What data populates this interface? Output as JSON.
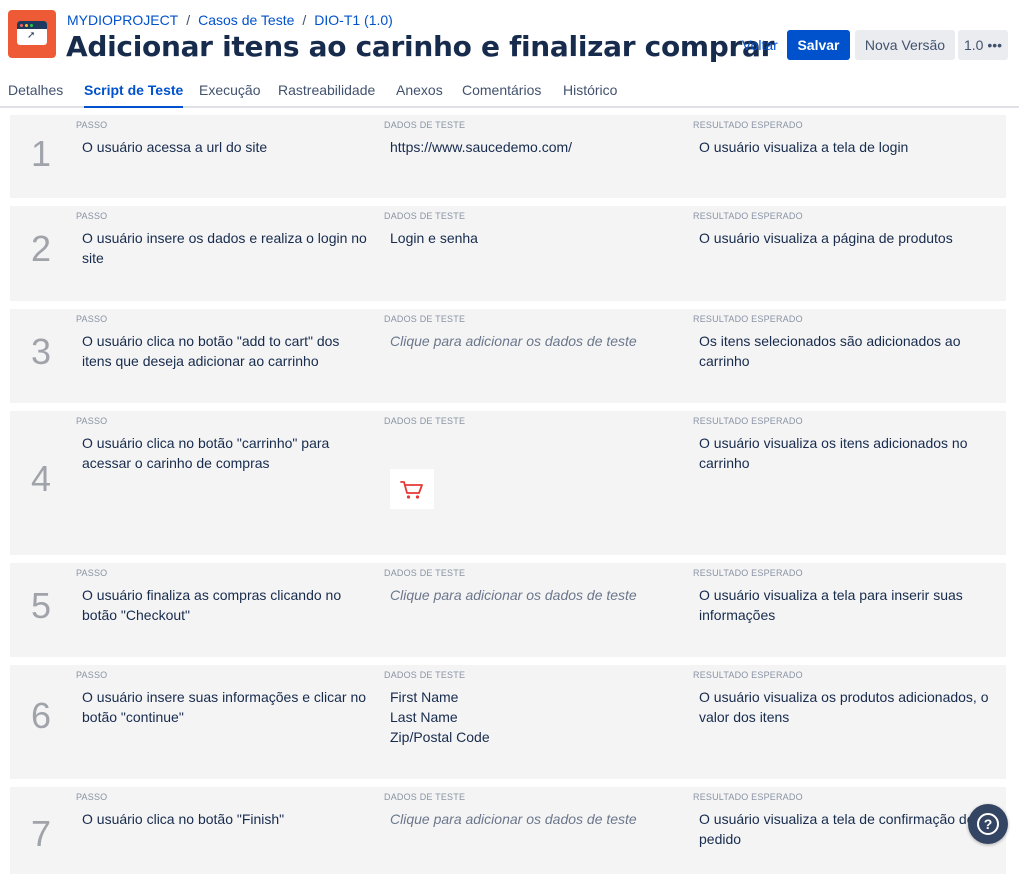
{
  "breadcrumb": {
    "project": "MYDIOPROJECT",
    "section": "Casos de Teste",
    "item": "DIO-T1 (1.0)",
    "separator": "/"
  },
  "title": "Adicionar itens ao carinho e finalizar comprar",
  "actions": {
    "back": "Voltar",
    "save": "Salvar",
    "new_version": "Nova Versão",
    "version": "1.0 •••"
  },
  "tabs": [
    {
      "label": "Detalhes"
    },
    {
      "label": "Script de Teste"
    },
    {
      "label": "Execução"
    },
    {
      "label": "Rastreabilidade"
    },
    {
      "label": "Anexos"
    },
    {
      "label": "Comentários"
    },
    {
      "label": "Histórico"
    }
  ],
  "active_tab": "Script de Teste",
  "columns": {
    "step": "PASSO",
    "data": "DADOS DE TESTE",
    "expected": "RESULTADO ESPERADO"
  },
  "steps": [
    {
      "num": "1",
      "step": "O usuário acessa a url do site",
      "data": "https://www.saucedemo.com/",
      "expected": "O usuário visualiza a tela de login"
    },
    {
      "num": "2",
      "step": "O usuário insere os dados e realiza o login no site",
      "data": "Login e senha",
      "expected": "O usuário visualiza a página de produtos"
    },
    {
      "num": "3",
      "step": "O usuário clica no botão \"add to cart\" dos itens que deseja adicionar ao carrinho",
      "data": "Clique para adicionar os dados de teste",
      "expected": "Os itens selecionados são adicionados ao carrinho"
    },
    {
      "num": "4",
      "step": "O usuário clica no botão \"carrinho\" para acessar o carinho de compras",
      "data": "",
      "expected": "O usuário visualiza os itens adicionados no carrinho"
    },
    {
      "num": "5",
      "step": "O usuário finaliza as compras clicando no botão \"Checkout\"",
      "data": "Clique para adicionar os dados de teste",
      "expected": "O usuário visualiza a tela para inserir suas informações"
    },
    {
      "num": "6",
      "step": "O usuário insere suas informações e clicar no botão \"continue\"",
      "data_lines": [
        "First Name",
        "Last Name",
        "Zip/Postal Code"
      ],
      "expected": "O usuário visualiza os produtos adicionados, o valor dos itens"
    },
    {
      "num": "7",
      "step": "O usuário clica no botão \"Finish\"",
      "data": "Clique para adicionar os dados de teste",
      "expected": "O usuário visualiza a tela de confirmação do pedido"
    }
  ],
  "icons": {
    "project_avatar": "project-window-icon",
    "cart": "shopping-cart-icon",
    "help": "help-icon"
  },
  "colors": {
    "primary": "#0052cc",
    "project_avatar": "#ee5a35",
    "cart": "#e53935",
    "help_button": "#344563"
  }
}
